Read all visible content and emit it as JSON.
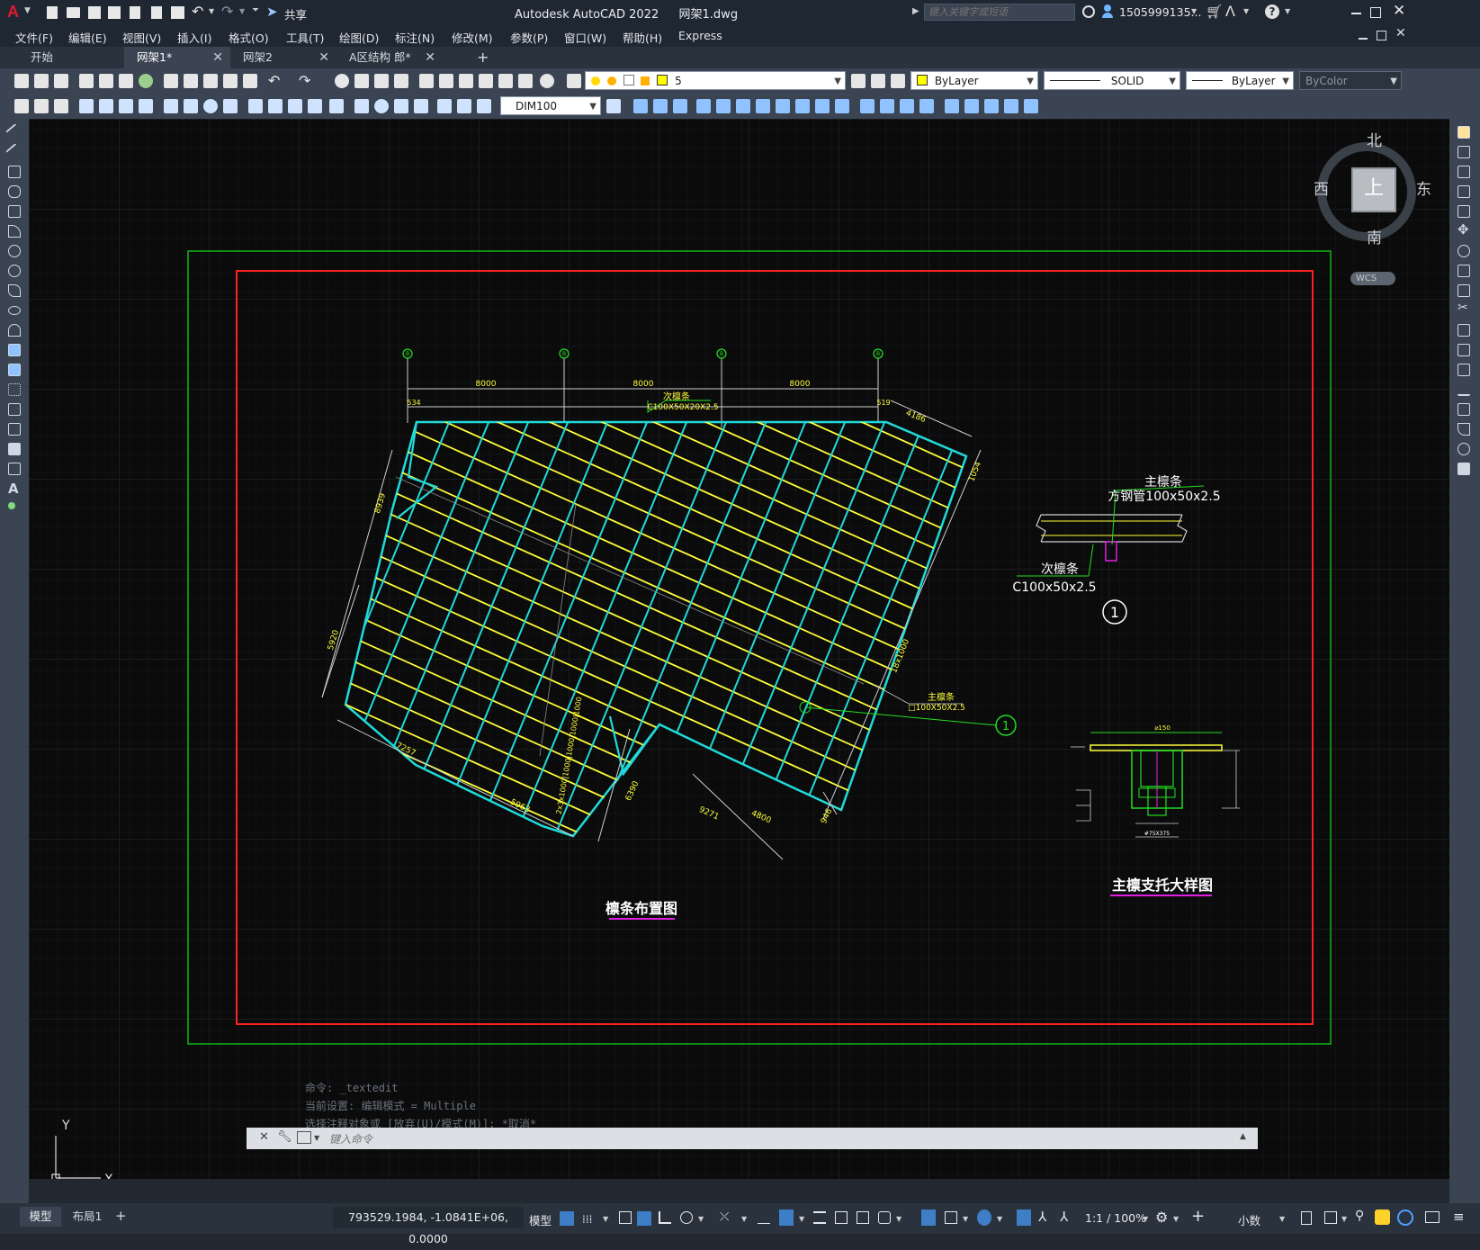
{
  "titlebar": {
    "app_title": "Autodesk AutoCAD 2022",
    "file_name": "网架1.dwg",
    "share_label": "共享",
    "search_placeholder": "键入关键字或短语",
    "user_name": "1505999135..."
  },
  "menu": [
    "文件(F)",
    "编辑(E)",
    "视图(V)",
    "插入(I)",
    "格式(O)",
    "工具(T)",
    "绘图(D)",
    "标注(N)",
    "修改(M)",
    "参数(P)",
    "窗口(W)",
    "帮助(H)",
    "Express"
  ],
  "file_tabs": [
    {
      "label": "开始",
      "closable": false,
      "active": false
    },
    {
      "label": "网架1*",
      "closable": true,
      "active": true
    },
    {
      "label": "网架2",
      "closable": true,
      "active": false
    },
    {
      "label": "A区结构 郎*",
      "closable": true,
      "active": false
    }
  ],
  "toolbar": {
    "layer_value": "5",
    "color_value": "ByLayer",
    "linetype_value": "SOLID",
    "lineweight_value": "ByLayer",
    "plotstyle_value": "ByColor",
    "dimstyle_value": "DIM100"
  },
  "viewcube": {
    "north": "北",
    "south": "南",
    "east": "东",
    "west": "西",
    "face": "上",
    "wcs": "WCS"
  },
  "drawing": {
    "plan_title": "檩条布置图",
    "detail_title": "主檩支托大样图",
    "grid_labels": [
      "B",
      "B",
      "B",
      "B"
    ],
    "top_dims": [
      "8000",
      "8000",
      "8000"
    ],
    "dim_534": "534",
    "dim_519": "519",
    "dim_4186": "4186",
    "dim_1054": "1054",
    "dim_8939": "8939",
    "dim_5920": "5920",
    "dim_7257": "7257",
    "dim_5963": "5963",
    "dim_6390": "6390",
    "dim_9271": "9271",
    "dim_4800": "4800",
    "dim_946": "946",
    "dim_18x1000": "18x1000",
    "dim_vertical": "2x3x1000|1000|1000|1000|1000",
    "secondary_label": "次檩条",
    "secondary_spec": "C100X50X20X2.5",
    "main_label": "主檩条",
    "main_spec": "□100X50X2.5",
    "callout": "1",
    "section_main_label": "主檩条",
    "section_main_spec": "方钢管100x50x2.5",
    "section_sec_label": "次檩条",
    "section_sec_spec": "C100x50x2.5",
    "section_mark": "1",
    "support_dim_top": "⌀150",
    "support_dim_bottom": "#75X375",
    "axis_y": "Y",
    "axis_x": "X"
  },
  "command": {
    "history": [
      "命令: _textedit",
      "当前设置: 编辑模式 = Multiple",
      "选择注释对象或 [放弃(U)/模式(M)]: *取消*"
    ],
    "placeholder": "键入命令"
  },
  "status": {
    "model_tab": "模型",
    "layout_tab": "布局1",
    "coords": "793529.1984, -1.0841E+06, 0.0000",
    "mode": "模型",
    "scale": "1:1 / 100%",
    "units": "小数"
  },
  "colors": {
    "canvas": "#0b0b0b",
    "border_outer": "#0fb80f",
    "border_inner": "#ff2020",
    "cyan": "#21d9d9",
    "yellow": "#ffff3a",
    "accent": "#c8102e"
  }
}
